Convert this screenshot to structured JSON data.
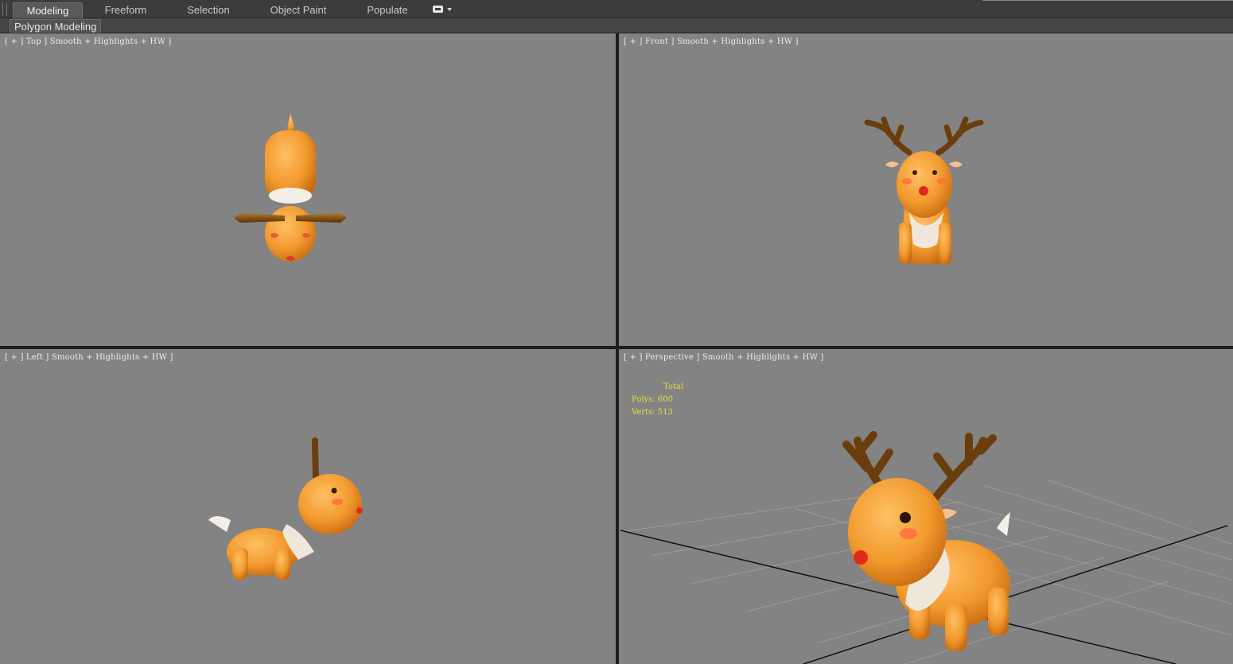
{
  "ribbon": {
    "tabs": [
      {
        "label": "Modeling",
        "active": true
      },
      {
        "label": "Freeform",
        "active": false
      },
      {
        "label": "Selection",
        "active": false
      },
      {
        "label": "Object Paint",
        "active": false
      },
      {
        "label": "Populate",
        "active": false
      }
    ],
    "extra_icon": "ribbon-options-icon",
    "panel_label": "Polygon Modeling"
  },
  "viewports": {
    "top": {
      "label": "[ + ] Top ] Smooth + Highlights + HW ]"
    },
    "front": {
      "label": "[ + ] Front ] Smooth + Highlights + HW ]"
    },
    "left": {
      "label": "[ + ] Left ] Smooth + Highlights + HW ]"
    },
    "perspective": {
      "label": "[ + ] Perspective ] Smooth + Highlights + HW ]",
      "stats": {
        "header": "Total",
        "polys": "Polys: 600",
        "verts": "Verts: 513"
      }
    }
  },
  "colors": {
    "viewport_bg": "#838383",
    "stats_text": "#e6df3c",
    "body_orange": "#f29a2e",
    "antler_brown": "#7a4a12"
  }
}
